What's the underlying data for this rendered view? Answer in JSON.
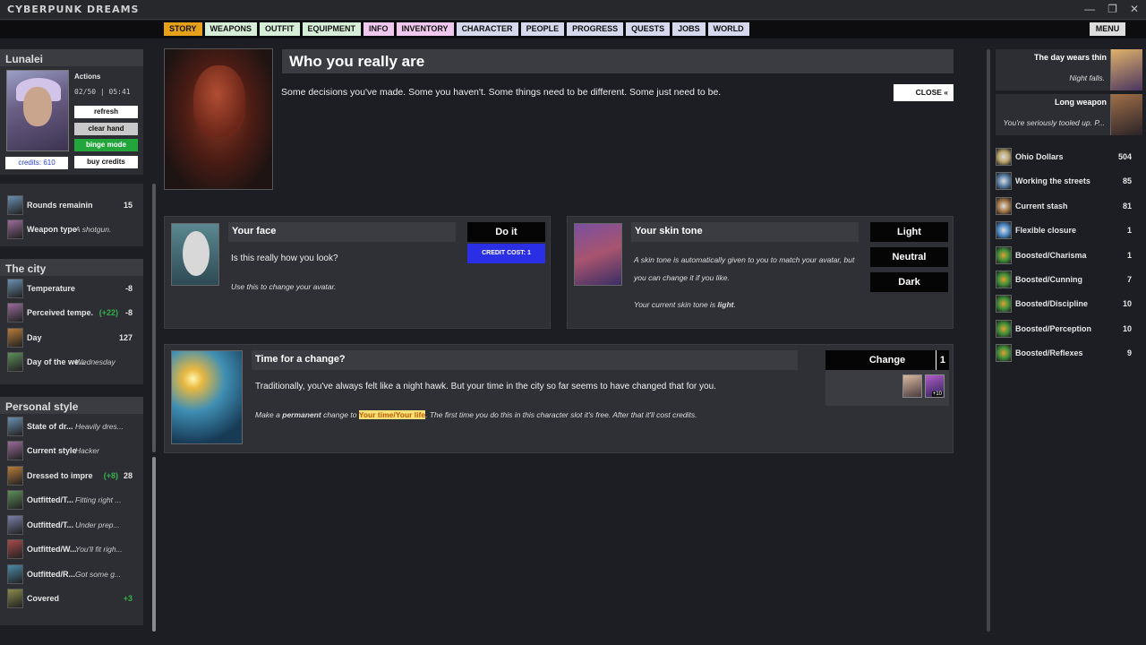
{
  "app": {
    "title": "CYBERPUNK DREAMS",
    "win": {
      "min": "—",
      "restore": "❐",
      "close": "✕"
    }
  },
  "nav": {
    "tabs": [
      {
        "label": "STORY",
        "color": "#e5a117"
      },
      {
        "label": "WEAPONS",
        "color": "#d6eed8"
      },
      {
        "label": "OUTFIT",
        "color": "#d6eed8"
      },
      {
        "label": "EQUIPMENT",
        "color": "#d6eed8"
      },
      {
        "label": "INFO",
        "color": "#f0c8ee"
      },
      {
        "label": "INVENTORY",
        "color": "#f0c8ee"
      },
      {
        "label": "CHARACTER",
        "color": "#d6d8ee"
      },
      {
        "label": "PEOPLE",
        "color": "#d6d8ee"
      },
      {
        "label": "PROGRESS",
        "color": "#d6d8ee"
      },
      {
        "label": "QUESTS",
        "color": "#d6d8ee"
      },
      {
        "label": "JOBS",
        "color": "#d6d8ee"
      },
      {
        "label": "WORLD",
        "color": "#d6d8ee"
      }
    ],
    "menu": "MENU"
  },
  "profile": {
    "name": "Lunalei",
    "actions_title": "Actions",
    "time": "02/50 | 05:41",
    "credits": "credits: 610",
    "buttons": {
      "refresh": "refresh",
      "clear": "clear hand",
      "binge": "binge mode",
      "buy": "buy credits"
    }
  },
  "weapon_stats": [
    {
      "label": "Rounds remaining",
      "value": "15",
      "icon": "rounds-icon"
    },
    {
      "label": "Weapon type",
      "value": "A shotgun.",
      "icon": "shotgun-icon"
    }
  ],
  "city": {
    "title": "The city",
    "stats": [
      {
        "label": "Temperature",
        "extra": "",
        "value": "-8"
      },
      {
        "label": "Perceived tempe...",
        "extra": "(+22)",
        "value": "-8"
      },
      {
        "label": "Day",
        "extra": "",
        "value": "127"
      },
      {
        "label": "Day of the we...",
        "extra": "",
        "value": "Wednesday"
      }
    ]
  },
  "style": {
    "title": "Personal style",
    "stats": [
      {
        "label": "State of dr...",
        "extra": "",
        "value": "Heavily dres..."
      },
      {
        "label": "Current style",
        "extra": "",
        "value": "Hacker"
      },
      {
        "label": "Dressed to impress",
        "extra": "(+8)",
        "value": "28"
      },
      {
        "label": "Outfitted/T...",
        "extra": "",
        "value": "Fitting right ..."
      },
      {
        "label": "Outfitted/T...",
        "extra": "",
        "value": "Under prep..."
      },
      {
        "label": "Outfitted/W...",
        "extra": "",
        "value": "You'll fit righ..."
      },
      {
        "label": "Outfitted/R...",
        "extra": "",
        "value": "Got some g..."
      },
      {
        "label": "Covered",
        "extra": "+3",
        "value": ""
      }
    ]
  },
  "main": {
    "title": "Who you really are",
    "subtitle": "Some decisions you've made. Some you haven't. Some things need to be different. Some just need to be.",
    "close": "CLOSE «"
  },
  "face_card": {
    "title": "Your face",
    "text": "Is this really how you look?",
    "note": "Use this to change your avatar.",
    "button": "Do it",
    "cost": "CREDIT COST: 1"
  },
  "skin_card": {
    "title": "Your skin tone",
    "note1": "A skin tone is automatically given to you to match your avatar, but you can change it if you like.",
    "note2_pre": "Your current skin tone is ",
    "note2_val": "light",
    "note2_post": ".",
    "buttons": [
      "Light",
      "Neutral",
      "Dark"
    ]
  },
  "time_card": {
    "title": "Time for a change?",
    "text": "Traditionally, you've always felt like a night hawk. But your time in the city so far seems to have changed that for you.",
    "note_pre": "Make a ",
    "note_bold": "permanent",
    "note_mid": " change to ",
    "note_link": "Your time/Your life",
    "note_post": ". The first time you do this in this character slot it's free. After that it'll cost credits.",
    "button": "Change",
    "count": "1",
    "thumb_badge": "+10"
  },
  "right": {
    "cards": [
      {
        "title": "The day wears thin",
        "desc": "Night falls."
      },
      {
        "title": "Long weapon",
        "desc": "You're seriously tooled up. P..."
      }
    ],
    "stats": [
      {
        "label": "Ohio Dollars",
        "value": "504"
      },
      {
        "label": "Working the streets",
        "value": "85"
      },
      {
        "label": "Current stash",
        "value": "81"
      },
      {
        "label": "Flexible closure",
        "value": "1"
      },
      {
        "label": "Boosted/Charisma",
        "value": "1"
      },
      {
        "label": "Boosted/Cunning",
        "value": "7"
      },
      {
        "label": "Boosted/Discipline",
        "value": "10"
      },
      {
        "label": "Boosted/Perception",
        "value": "10"
      },
      {
        "label": "Boosted/Reflexes",
        "value": "9"
      }
    ]
  }
}
